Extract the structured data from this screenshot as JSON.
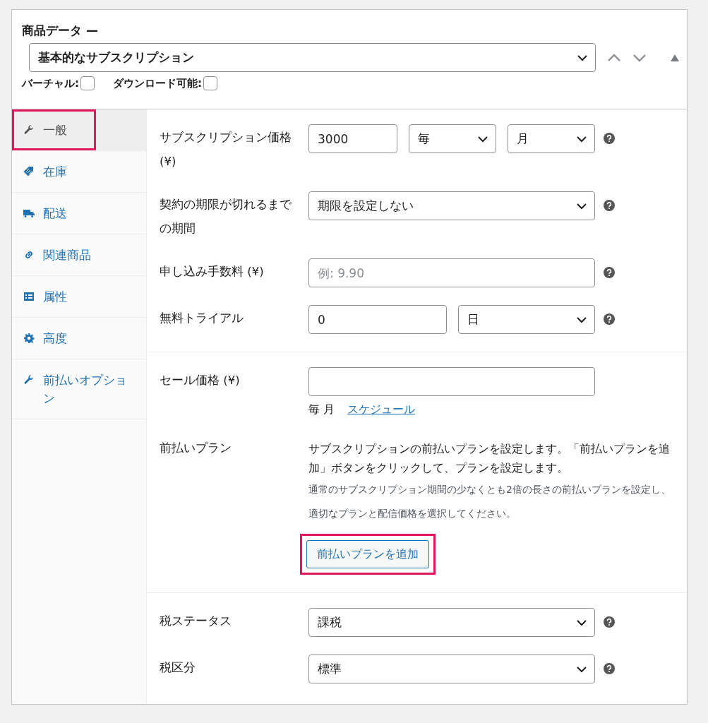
{
  "panel": {
    "title": "商品データ —",
    "product_type": "基本的なサブスクリプション",
    "options": [
      {
        "label": "バーチャル:",
        "checked": false
      },
      {
        "label": "ダウンロード可能:",
        "checked": false
      }
    ]
  },
  "tabs": [
    {
      "label": "一般",
      "kind": "wrench",
      "selected": true,
      "highlighted": true
    },
    {
      "label": "在庫",
      "kind": "tag",
      "selected": false,
      "highlighted": false
    },
    {
      "label": "配送",
      "kind": "truck",
      "selected": false,
      "highlighted": false
    },
    {
      "label": "関連商品",
      "kind": "link",
      "selected": false,
      "highlighted": false
    },
    {
      "label": "属性",
      "kind": "list",
      "selected": false,
      "highlighted": false
    },
    {
      "label": "高度",
      "kind": "gear",
      "selected": false,
      "highlighted": false
    },
    {
      "label": "前払いオプション",
      "kind": "wrench",
      "selected": false,
      "highlighted": false
    }
  ],
  "groups": [
    {
      "rows": [
        {
          "kind": "fields",
          "label": "サブスクリプション価格 (¥)",
          "help": true,
          "controls": [
            {
              "kind": "input",
              "value": "3000"
            },
            {
              "kind": "select",
              "value": "毎"
            },
            {
              "kind": "select",
              "value": "月"
            }
          ]
        },
        {
          "kind": "fields",
          "label": "契約の期限が切れるまでの期間",
          "help": true,
          "controls": [
            {
              "kind": "select",
              "value": "期限を設定しない"
            }
          ]
        },
        {
          "kind": "fields",
          "label": "申し込み手数料 (¥)",
          "help": true,
          "controls": [
            {
              "kind": "input",
              "placeholder": "例: 9.90"
            }
          ]
        },
        {
          "kind": "fields",
          "label": "無料トライアル",
          "help": true,
          "controls": [
            {
              "kind": "input",
              "value": "0"
            },
            {
              "kind": "select",
              "value": "日"
            }
          ]
        }
      ]
    },
    {
      "rows": [
        {
          "kind": "fields",
          "label": "セール価格 (¥)",
          "help": false,
          "controls": [
            {
              "kind": "input"
            }
          ],
          "schedule": {
            "period": "毎 月",
            "link": "スケジュール"
          }
        },
        {
          "kind": "prepay",
          "label": "前払いプラン",
          "description": "サブスクリプションの前払いプランを設定します。「前払いプランを追加」ボタンをクリックして、プランを設定します。",
          "note": "通常のサブスクリプション期間の少なくとも2倍の長さの前払いプランを設定し、適切なプランと配信価格を選択してください。",
          "button": "前払いプランを追加",
          "highlighted": true
        }
      ]
    },
    {
      "rows": [
        {
          "kind": "fields",
          "label": "税ステータス",
          "help": true,
          "controls": [
            {
              "kind": "select",
              "value": "課税"
            }
          ]
        },
        {
          "kind": "fields",
          "label": "税区分",
          "help": true,
          "controls": [
            {
              "kind": "select",
              "value": "標準"
            }
          ]
        }
      ]
    }
  ]
}
